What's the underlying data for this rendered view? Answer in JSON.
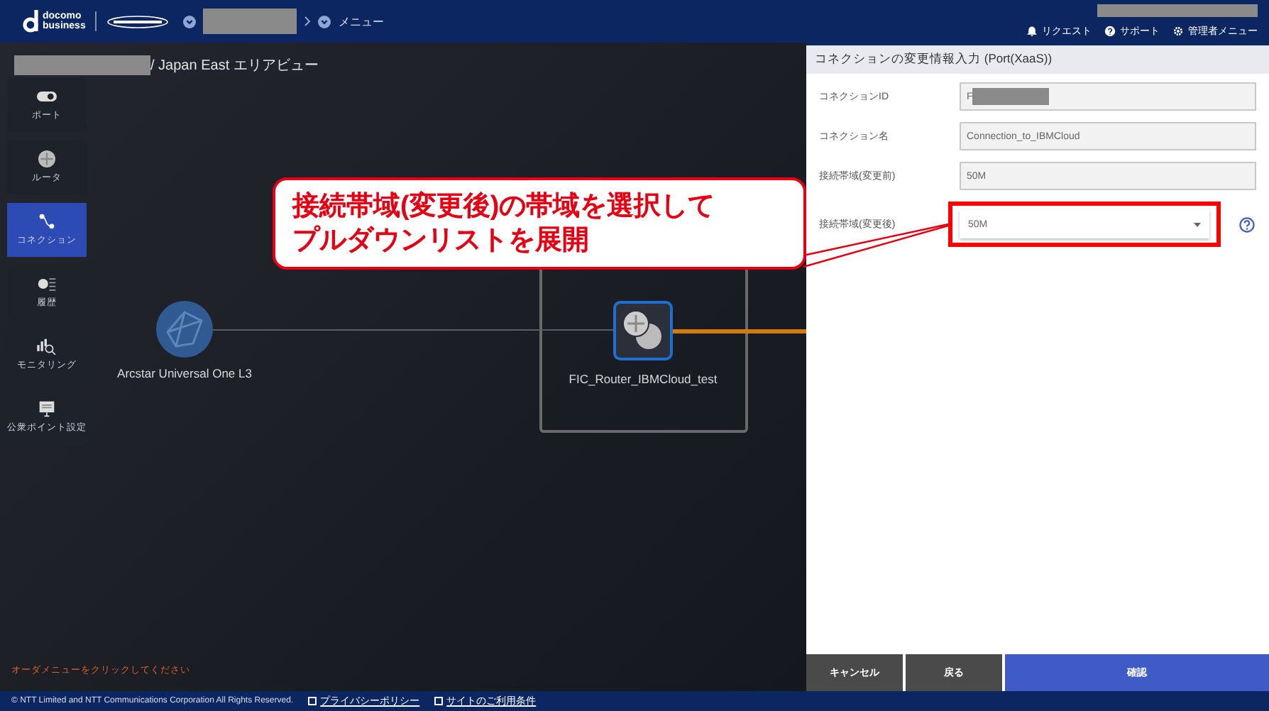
{
  "header": {
    "logo": [
      "docomo",
      "business"
    ],
    "partner_logo": {
      "kind": "ntt"
    },
    "breadcrumb": [
      {
        "kind": "redacted"
      },
      {
        "kind": "label",
        "text": "メニュー"
      }
    ],
    "account": {
      "kind": "redacted"
    },
    "links": [
      {
        "kind": "bell",
        "label": "リクエスト"
      },
      {
        "kind": "help",
        "label": "サポート"
      },
      {
        "kind": "gear",
        "label": "管理者メニュー"
      }
    ]
  },
  "area_title": {
    "prefix": {
      "kind": "redacted"
    },
    "text": "/ Japan East エリアビュー"
  },
  "sidebar": [
    {
      "kind": "port",
      "label": "ポート",
      "selected": false
    },
    {
      "kind": "router",
      "label": "ルータ",
      "selected": false
    },
    {
      "kind": "connection",
      "label": "コネクション",
      "selected": true
    },
    {
      "kind": "history",
      "label": "履歴",
      "selected": false
    },
    {
      "kind": "monitor",
      "label": "モニタリング",
      "selected": false
    },
    {
      "kind": "screen",
      "label": "公衆ポイント設定",
      "selected": false
    }
  ],
  "canvas": {
    "nodes": [
      {
        "kind": "network",
        "label": "Arcstar Universal One L3"
      },
      {
        "kind": "router",
        "label": "FIC_Router_IBMCloud_test"
      }
    ]
  },
  "status_message": "オーダメニューをクリックしてください",
  "panel": {
    "title": "コネクションの変更情報入力 (Port(XaaS))",
    "fields": [
      {
        "label": "コネクションID",
        "kind": "readonly",
        "value": "F",
        "redacted": true
      },
      {
        "label": "コネクション名",
        "kind": "readonly",
        "value": "Connection_to_IBMCloud"
      },
      {
        "label": "接続帯域(変更前)",
        "kind": "readonly",
        "value": "50M"
      },
      {
        "label": "接続帯域(変更後)",
        "kind": "select",
        "value": "50M",
        "highlighted": true,
        "help": true
      }
    ],
    "buttons": [
      {
        "label": "キャンセル",
        "kind": "secondary"
      },
      {
        "label": "戻る",
        "kind": "secondary"
      },
      {
        "label": "確認",
        "kind": "primary"
      }
    ]
  },
  "callout": {
    "lines": [
      "接続帯域(変更後)の帯域を選択して",
      "プルダウンリストを展開"
    ]
  },
  "footer": {
    "copyright": "© NTT Limited and NTT Communications Corporation All Rights Reserved.",
    "links": [
      "プライバシーポリシー",
      "サイトのご利用条件"
    ]
  }
}
